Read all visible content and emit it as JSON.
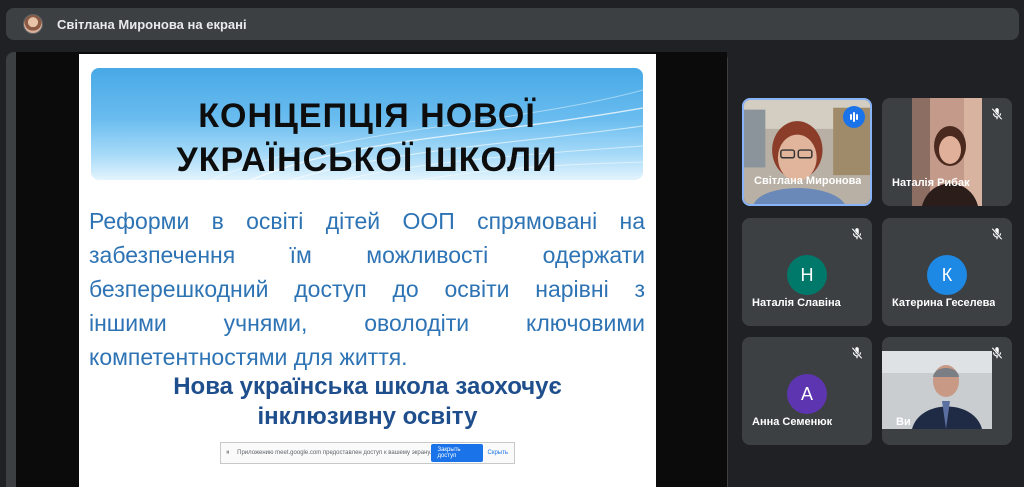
{
  "topbar": {
    "title": "Світлана Миронова на екрані"
  },
  "slide": {
    "banner_title_line1": "КОНЦЕПЦІЯ НОВОЇ",
    "banner_title_line2": "УКРАЇНСЬКОЇ ШКОЛИ",
    "body_lines": [
      "Реформи в освіті дітей ООП спрямовані на",
      "забезпечення їм можливості одержати",
      "безперешкодний доступ до освіти нарівні з",
      "іншими учнями, оволодіти ключовими",
      "компетентностями для життя."
    ],
    "emphasis_line1": "Нова українська школа заохочує",
    "emphasis_line2": "інклюзивну освіту"
  },
  "share_notification": {
    "text": "Приложению meet.google.com предоставлен доступ к вашему экрану.",
    "stop_label": "Закрыть доступ",
    "hide_label": "Скрыть"
  },
  "participants": [
    {
      "name": "Світлана Миронова",
      "type": "video",
      "speaking": true
    },
    {
      "name": "Наталія Рибак",
      "type": "video",
      "muted": true
    },
    {
      "name": "Наталія Славіна",
      "type": "avatar",
      "initial": "Н",
      "color": "#00796b",
      "muted": true
    },
    {
      "name": "Катерина Геселева",
      "type": "avatar",
      "initial": "К",
      "color": "#1e88e5",
      "muted": true
    },
    {
      "name": "Анна Семенюк",
      "type": "avatar",
      "initial": "А",
      "color": "#5e35b1",
      "muted": true
    },
    {
      "name": "Ви",
      "type": "video",
      "muted": true
    }
  ]
}
